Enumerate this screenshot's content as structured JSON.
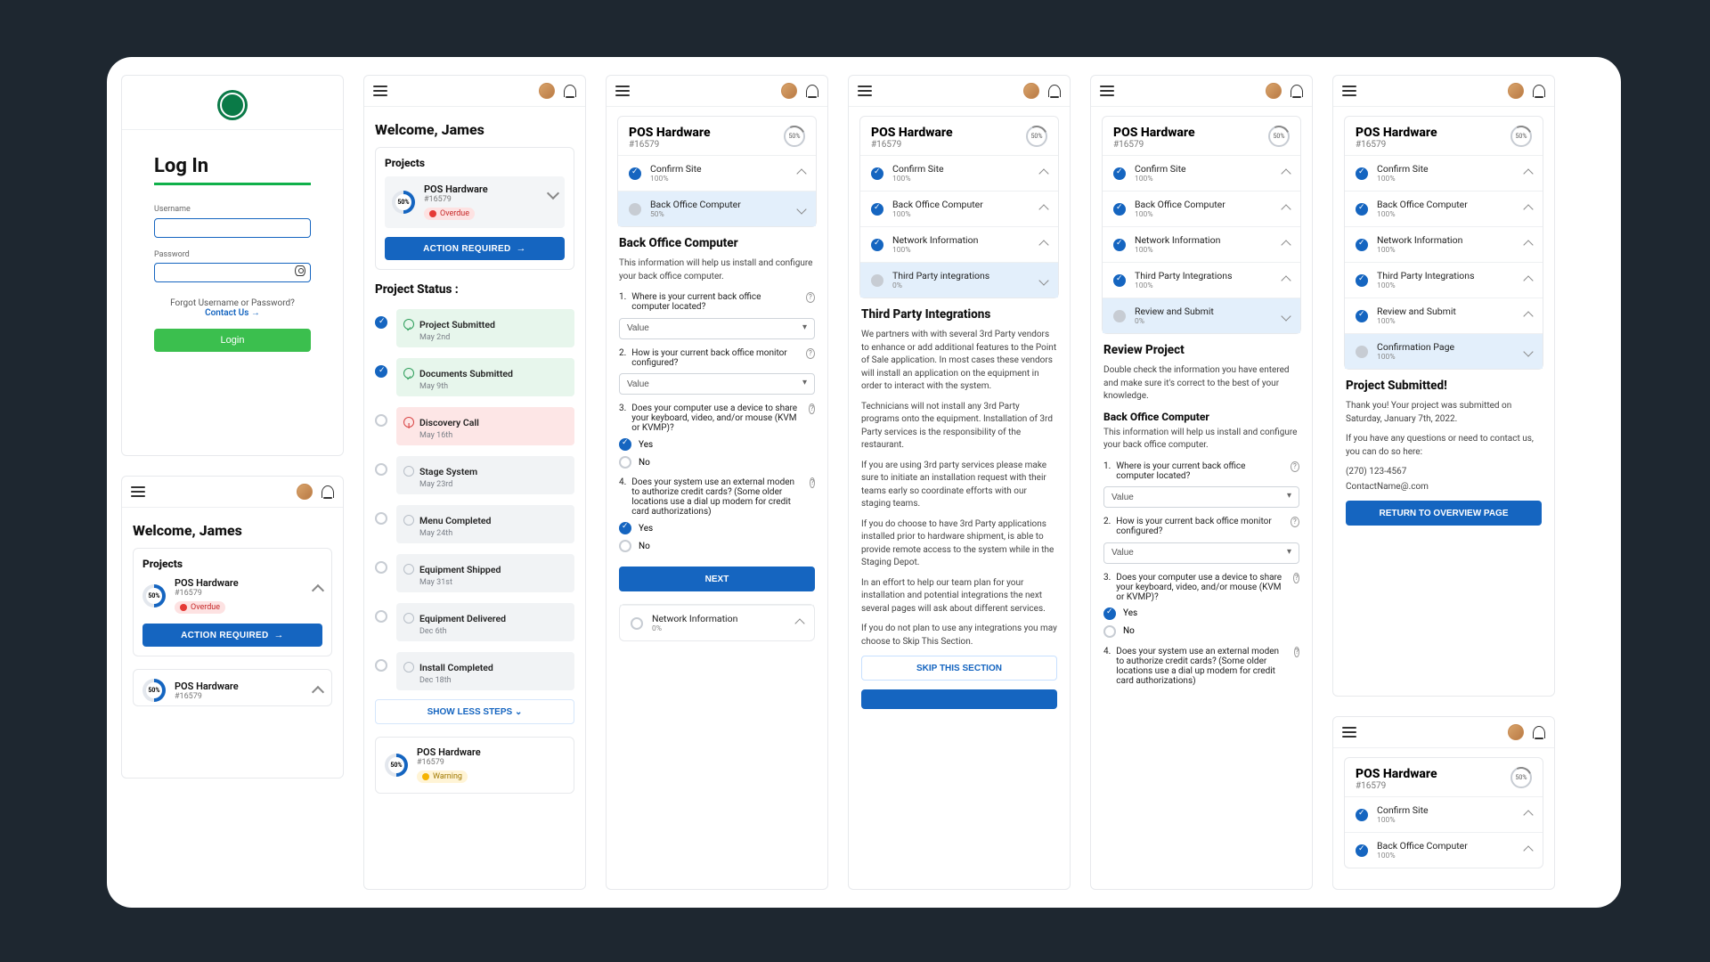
{
  "login": {
    "title": "Log In",
    "username_label": "Username",
    "password_label": "Password",
    "forgot": "Forgot Username or Password?",
    "contact": "Contact Us →",
    "login_btn": "Login"
  },
  "welcome": {
    "greeting": "Welcome, James",
    "projects_label": "Projects",
    "action_required": "ACTION REQUIRED",
    "project_status_label": "Project Status :",
    "show_less": "SHOW LESS STEPS  ⌄",
    "proj": {
      "name": "POS Hardware",
      "id": "#16579",
      "pct": "50%",
      "overdue": "Overdue",
      "warning": "Warning"
    },
    "steps": [
      {
        "title": "Project Submitted",
        "date": "May 2nd",
        "state": "green",
        "done": true
      },
      {
        "title": "Documents Submitted",
        "date": "May 9th",
        "state": "green",
        "done": true
      },
      {
        "title": "Discovery Call",
        "date": "May 16th",
        "state": "red",
        "done": false
      },
      {
        "title": "Stage System",
        "date": "May 23rd",
        "state": "grey",
        "done": false
      },
      {
        "title": "Menu Completed",
        "date": "May 24th",
        "state": "grey",
        "done": false
      },
      {
        "title": "Equipment Shipped",
        "date": "May 31st",
        "state": "grey",
        "done": false
      },
      {
        "title": "Equipment Delivered",
        "date": "Dec 6th",
        "state": "grey",
        "done": false
      },
      {
        "title": "Install Completed",
        "date": "Dec 18th",
        "state": "grey",
        "done": false
      }
    ]
  },
  "proj_header": {
    "title": "POS Hardware",
    "id": "#16579",
    "pct": "50%"
  },
  "acc": {
    "confirm": {
      "label": "Confirm Site",
      "pct": "100%"
    },
    "back50": {
      "label": "Back Office Computer",
      "pct": "50%"
    },
    "back100": {
      "label": "Back Office Computer",
      "pct": "100%"
    },
    "net0": {
      "label": "Network Information",
      "pct": "0%"
    },
    "net100": {
      "label": "Network Information",
      "pct": "100%"
    },
    "tpi0": {
      "label": "Third Party integrations",
      "pct": "0%"
    },
    "tpi100": {
      "label": "Third Party Integrations",
      "pct": "100%"
    },
    "review0": {
      "label": "Review and Submit",
      "pct": "0%"
    },
    "review100": {
      "label": "Review and Submit",
      "pct": "100%"
    },
    "confpage": {
      "label": "Confirmation Page",
      "pct": "100%"
    }
  },
  "boc": {
    "heading": "Back Office Computer",
    "intro": "This information will help us install and configure your back office computer.",
    "q1": "Where is your current back office computer located?",
    "q2": "How is your current back office monitor configured?",
    "q3": "Does your computer use a device to share your keyboard, video, and/or mouse (KVM or KVMP)?",
    "q4": "Does your system use an external moden to authorize credit cards? (Some older locations use a dial up modem for credit card authorizations)",
    "value": "Value",
    "yes": "Yes",
    "no": "No",
    "next": "NEXT"
  },
  "tpi": {
    "heading": "Third Party Integrations",
    "p1": "We partners with with several 3rd Party vendors to enhance or add additional features to the  Point of Sale application. In most cases these vendors will install an application on the  equipment in order to interact with the system.",
    "p2": "Technicians will not install any 3rd Party programs onto the  equipment. Installation of 3rd Party services is the responsibility of the restaurant.",
    "p3": "If you are using 3rd party services please make sure to initiate an installation request with their teams early so coordinate efforts with our staging teams.",
    "p4": "If you do choose to have 3rd Party applications installed prior to hardware shipment,  is able to provide remote access to the system while in the Staging Depot.",
    "p5": "In an effort to help our team plan for your installation and potential integrations the next several pages will ask about different services.",
    "p6": "If you do not plan to use any integrations you may choose to Skip This Section.",
    "skip": "SKIP THIS SECTION"
  },
  "review": {
    "heading": "Review Project",
    "intro": "Double check the information you  have entered and make sure it's correct to the best of your knowledge."
  },
  "submitted": {
    "heading": "Project Submitted!",
    "p1": "Thank you! Your project was submitted on Saturday, January 7th, 2022.",
    "p2": "If you have any questions or need to contact us, you can do so here:",
    "phone": "(270) 123-4567",
    "email": "ContactName@.com",
    "return": "RETURN TO OVERVIEW PAGE"
  }
}
